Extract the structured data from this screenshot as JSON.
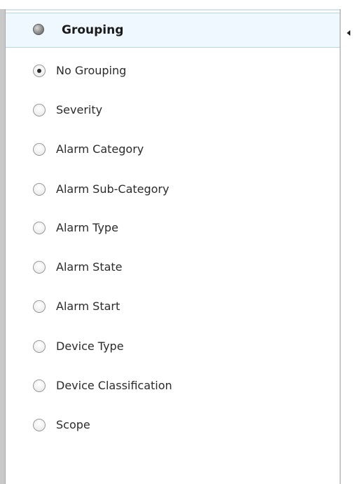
{
  "header": {
    "title": "Grouping",
    "icon": "radio-group-icon"
  },
  "options": [
    {
      "label": "No Grouping",
      "checked": true
    },
    {
      "label": "Severity",
      "checked": false
    },
    {
      "label": "Alarm Category",
      "checked": false
    },
    {
      "label": "Alarm Sub-Category",
      "checked": false
    },
    {
      "label": "Alarm Type",
      "checked": false
    },
    {
      "label": "Alarm State",
      "checked": false
    },
    {
      "label": "Alarm Start",
      "checked": false
    },
    {
      "label": "Device Type",
      "checked": false
    },
    {
      "label": "Device Classification",
      "checked": false
    },
    {
      "label": "Scope",
      "checked": false
    }
  ],
  "splitter": {
    "icon": "collapse-left-arrow-icon"
  },
  "colors": {
    "header_bg": "#f0f8ff",
    "header_border": "#b8d6ea",
    "text": "#2b2b2b"
  }
}
